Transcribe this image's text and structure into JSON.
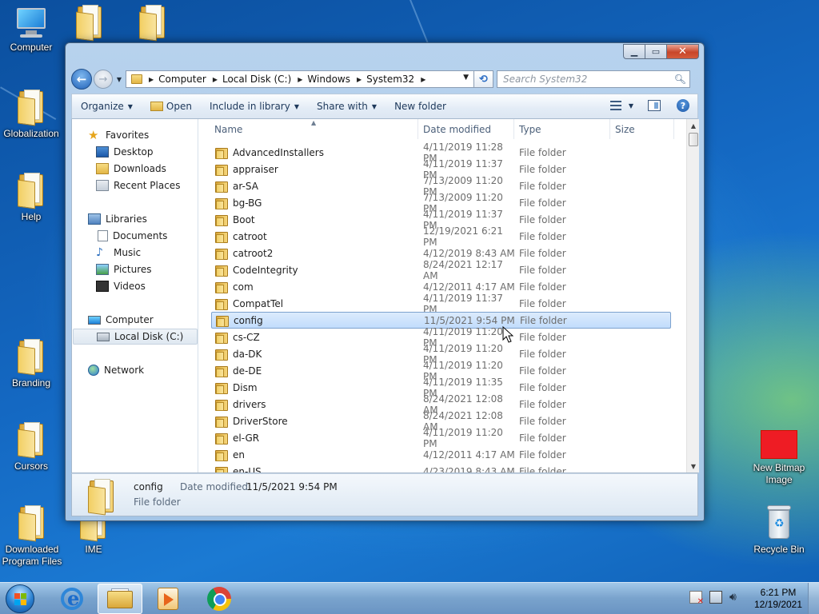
{
  "desktop": {
    "icons": [
      {
        "label": "Computer"
      },
      {
        "label": ""
      },
      {
        "label": ""
      },
      {
        "label": "Globalization"
      },
      {
        "label": "Help"
      },
      {
        "label": "Branding"
      },
      {
        "label": "Cursors"
      },
      {
        "label": "Downloaded Program Files"
      },
      {
        "label": "IME"
      },
      {
        "label": "New Bitmap Image"
      },
      {
        "label": "Recycle Bin"
      }
    ]
  },
  "window": {
    "address": {
      "crumbs": [
        "Computer",
        "Local Disk (C:)",
        "Windows",
        "System32"
      ]
    },
    "search": {
      "placeholder": "Search System32"
    },
    "toolbar": {
      "organize": "Organize",
      "open": "Open",
      "include": "Include in library",
      "share": "Share with",
      "new_folder": "New folder"
    },
    "navpane": {
      "favorites": "Favorites",
      "desktop": "Desktop",
      "downloads": "Downloads",
      "recent": "Recent Places",
      "libraries": "Libraries",
      "documents": "Documents",
      "music": "Music",
      "pictures": "Pictures",
      "videos": "Videos",
      "computer": "Computer",
      "local_disk": "Local Disk (C:)",
      "network": "Network"
    },
    "columns": {
      "name": "Name",
      "date": "Date modified",
      "type": "Type",
      "size": "Size"
    },
    "files": [
      {
        "name": "AdvancedInstallers",
        "date": "4/11/2019 11:28 PM",
        "type": "File folder"
      },
      {
        "name": "appraiser",
        "date": "4/11/2019 11:37 PM",
        "type": "File folder"
      },
      {
        "name": "ar-SA",
        "date": "7/13/2009 11:20 PM",
        "type": "File folder"
      },
      {
        "name": "bg-BG",
        "date": "7/13/2009 11:20 PM",
        "type": "File folder"
      },
      {
        "name": "Boot",
        "date": "4/11/2019 11:37 PM",
        "type": "File folder"
      },
      {
        "name": "catroot",
        "date": "12/19/2021 6:21 PM",
        "type": "File folder"
      },
      {
        "name": "catroot2",
        "date": "4/12/2019 8:43 AM",
        "type": "File folder"
      },
      {
        "name": "CodeIntegrity",
        "date": "8/24/2021 12:17 AM",
        "type": "File folder"
      },
      {
        "name": "com",
        "date": "4/12/2011 4:17 AM",
        "type": "File folder"
      },
      {
        "name": "CompatTel",
        "date": "4/11/2019 11:37 PM",
        "type": "File folder"
      },
      {
        "name": "config",
        "date": "11/5/2021 9:54 PM",
        "type": "File folder"
      },
      {
        "name": "cs-CZ",
        "date": "4/11/2019 11:20 PM",
        "type": "File folder"
      },
      {
        "name": "da-DK",
        "date": "4/11/2019 11:20 PM",
        "type": "File folder"
      },
      {
        "name": "de-DE",
        "date": "4/11/2019 11:20 PM",
        "type": "File folder"
      },
      {
        "name": "Dism",
        "date": "4/11/2019 11:35 PM",
        "type": "File folder"
      },
      {
        "name": "drivers",
        "date": "8/24/2021 12:08 AM",
        "type": "File folder"
      },
      {
        "name": "DriverStore",
        "date": "8/24/2021 12:08 AM",
        "type": "File folder"
      },
      {
        "name": "el-GR",
        "date": "4/11/2019 11:20 PM",
        "type": "File folder"
      },
      {
        "name": "en",
        "date": "4/12/2011 4:17 AM",
        "type": "File folder"
      },
      {
        "name": "en-US",
        "date": "4/23/2019 8:43 AM",
        "type": "File folder"
      }
    ],
    "details": {
      "name": "config",
      "modified_label": "Date modified:",
      "modified_value": "11/5/2021 9:54 PM",
      "type": "File folder"
    }
  },
  "taskbar": {
    "clock": {
      "time": "6:21 PM",
      "date": "12/19/2021"
    }
  },
  "colors": {
    "selection": "#c1dcfc",
    "close_button": "#c8462a",
    "accent": "#1b58a8"
  }
}
